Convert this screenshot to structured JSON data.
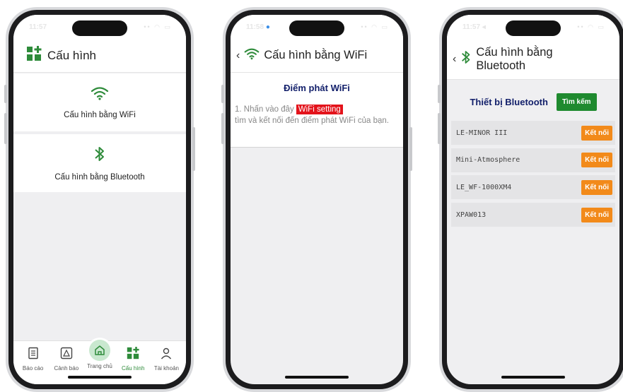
{
  "phone1": {
    "header_title": "Cấu hình",
    "options": [
      {
        "label": "Cấu hình bằng WiFi"
      },
      {
        "label": "Cấu hình bằng Bluetooth"
      }
    ],
    "tabs": [
      {
        "label": "Báo cáo",
        "icon": "report-icon"
      },
      {
        "label": "Cảnh báo",
        "icon": "alert-icon"
      },
      {
        "label": "Trang chủ",
        "icon": "home-icon"
      },
      {
        "label": "Cấu hình",
        "icon": "config-icon",
        "active": true
      },
      {
        "label": "Tài khoản",
        "icon": "account-icon"
      }
    ]
  },
  "phone2": {
    "nav_title": "Cấu hình bằng WiFi",
    "section_title": "Điểm phát WiFi",
    "instruction_prefix": "1. Nhấn vào đây",
    "wifi_link": "WiFi setting",
    "instruction_rest": "tìm và kết nối đến điểm phát WiFi của bạn."
  },
  "phone3": {
    "nav_title_1": "Cấu hình bằng",
    "nav_title_2": "Bluetooth",
    "section_title": "Thiết bị Bluetooth",
    "search_label": "Tìm kếm",
    "devices": [
      {
        "name": "LE-MINOR III",
        "action": "Kết nối"
      },
      {
        "name": "Mini-Atmosphere",
        "action": "Kết nối"
      },
      {
        "name": "LE_WF-1000XM4",
        "action": "Kết nối"
      },
      {
        "name": "XPAW013",
        "action": "Kết nối"
      }
    ]
  },
  "colors": {
    "brand_green": "#2e8b3a",
    "navy": "#13206b",
    "link_red": "#e3131b",
    "orange": "#f28a1a"
  }
}
